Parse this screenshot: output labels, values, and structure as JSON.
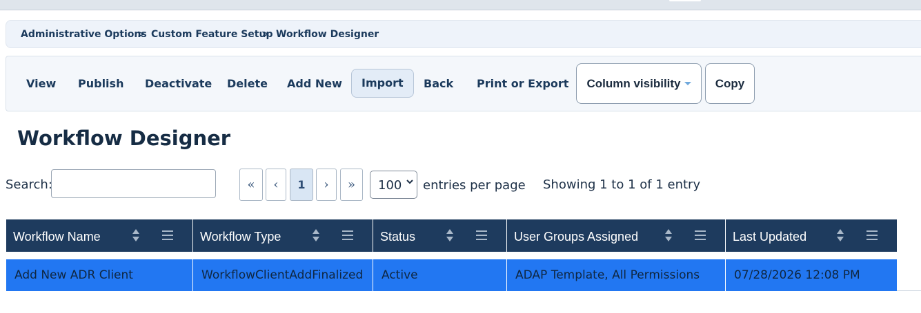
{
  "breadcrumb": {
    "items": [
      "Administrative Options",
      "Custom Feature Setup",
      "Workflow Designer"
    ],
    "separator": ">"
  },
  "toolbar": {
    "view": "View",
    "publish": "Publish",
    "deactivate": "Deactivate",
    "delete": "Delete",
    "add_new": "Add New",
    "import": "Import",
    "back": "Back",
    "print_export": "Print or Export",
    "column_visibility": "Column visibility",
    "copy": "Copy"
  },
  "page_title": "Workflow Designer",
  "search": {
    "label": "Search:",
    "value": ""
  },
  "pagination": {
    "first": "«",
    "prev": "‹",
    "current": "1",
    "next": "›",
    "last": "»"
  },
  "per_page": {
    "value": "100",
    "label": "entries per page"
  },
  "showing": "Showing 1 to 1 of 1 entry",
  "table": {
    "columns": [
      "Workflow Name",
      "Workflow Type",
      "Status",
      "User Groups Assigned",
      "Last Updated"
    ],
    "rows": [
      [
        "Add New ADR Client",
        "WorkflowClientAddFinalized",
        "Active",
        "ADAP Template, All Permissions",
        "07/28/2026 12:08 PM"
      ]
    ]
  },
  "colors": {
    "header_bg": "#1e3b5e",
    "selected_row": "#2277f2",
    "accent": "#1b3a5c"
  },
  "icons": {
    "sort": "sort-updown-icon",
    "column_menu": "hamburger-menu-icon",
    "dropdown": "caret-down-icon"
  }
}
